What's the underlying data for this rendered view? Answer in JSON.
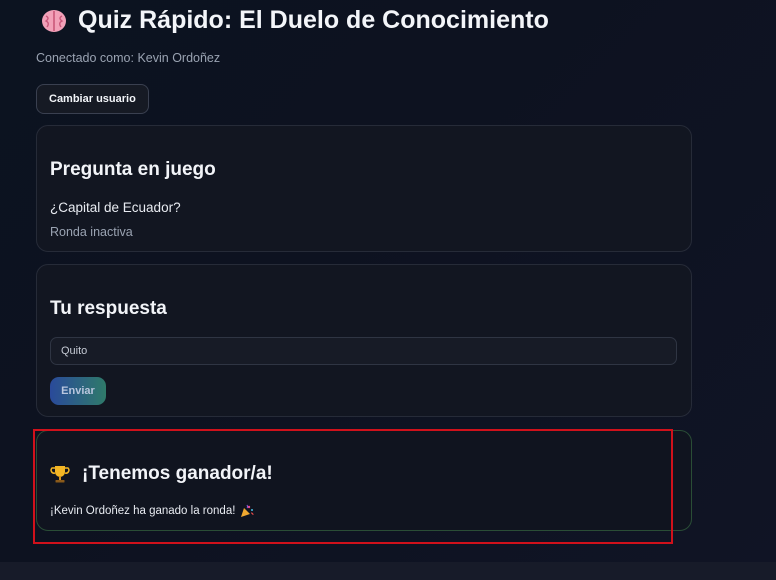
{
  "header": {
    "title_icon": "brain-icon",
    "title": "Quiz Rápido: El Duelo de Conocimiento",
    "connected_as": "Conectado como: Kevin Ordoñez",
    "change_user_label": "Cambiar usuario"
  },
  "question_card": {
    "heading": "Pregunta en juego",
    "question": "¿Capital de Ecuador?",
    "status": "Ronda inactiva"
  },
  "answer_card": {
    "heading": "Tu respuesta",
    "answer_value": "Quito",
    "submit_label": "Enviar"
  },
  "winner_card": {
    "icon": "trophy-icon",
    "heading": "¡Tenemos ganador/a!",
    "message": "¡Kevin Ordoñez ha ganado la ronda!",
    "message_icon": "party-popper-icon"
  },
  "colors": {
    "background": "#0d1220",
    "card": "#121621",
    "winner_border": "#2a4d36",
    "highlight": "#d0111b",
    "button_gradient_start": "#2a4a9a",
    "button_gradient_end": "#2f7a6a"
  }
}
